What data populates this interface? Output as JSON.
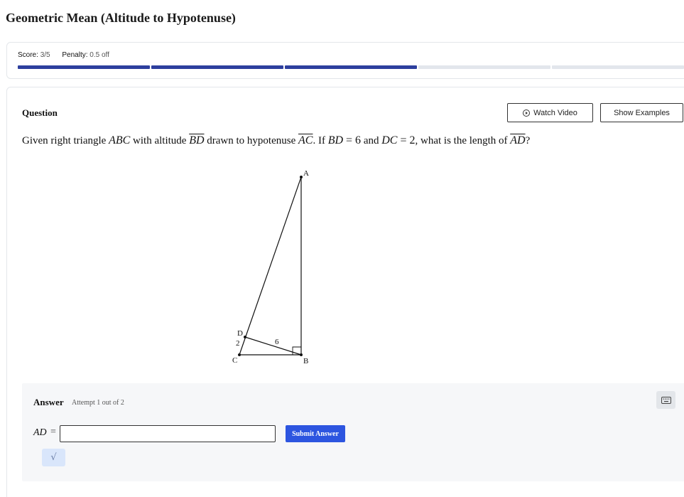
{
  "page": {
    "title": "Geometric Mean (Altitude to Hypotenuse)"
  },
  "score": {
    "score_label": "Score:",
    "score_value": "3/5",
    "penalty_label": "Penalty:",
    "penalty_value": "0.5 off",
    "progress_segments": 5,
    "progress_filled": 3,
    "progress_color": "#2d3f9e"
  },
  "question": {
    "label": "Question",
    "watch_video": "Watch Video",
    "show_examples": "Show Examples",
    "text": {
      "p1": "Given right triangle ",
      "m1": "ABC",
      "p2": " with altitude ",
      "m2": "BD",
      "p3": " drawn to hypotenuse ",
      "m3": "AC",
      "p4": ". If ",
      "m4": "BD",
      "eq1": " = 6",
      "p5": " and ",
      "m5": "DC",
      "eq2": " = 2",
      "p6": ", what is the length of ",
      "m6": "AD",
      "p7": "?"
    }
  },
  "diagram": {
    "points": {
      "A": "A",
      "B": "B",
      "C": "C",
      "D": "D"
    },
    "labels": {
      "BD": "6",
      "DC": "2"
    }
  },
  "answer": {
    "label": "Answer",
    "attempt": "Attempt 1 out of 2",
    "variable": "AD",
    "equals": "=",
    "input_value": "",
    "submit": "Submit Answer",
    "sqrt_button": "√",
    "accent_color": "#2d55e0"
  }
}
